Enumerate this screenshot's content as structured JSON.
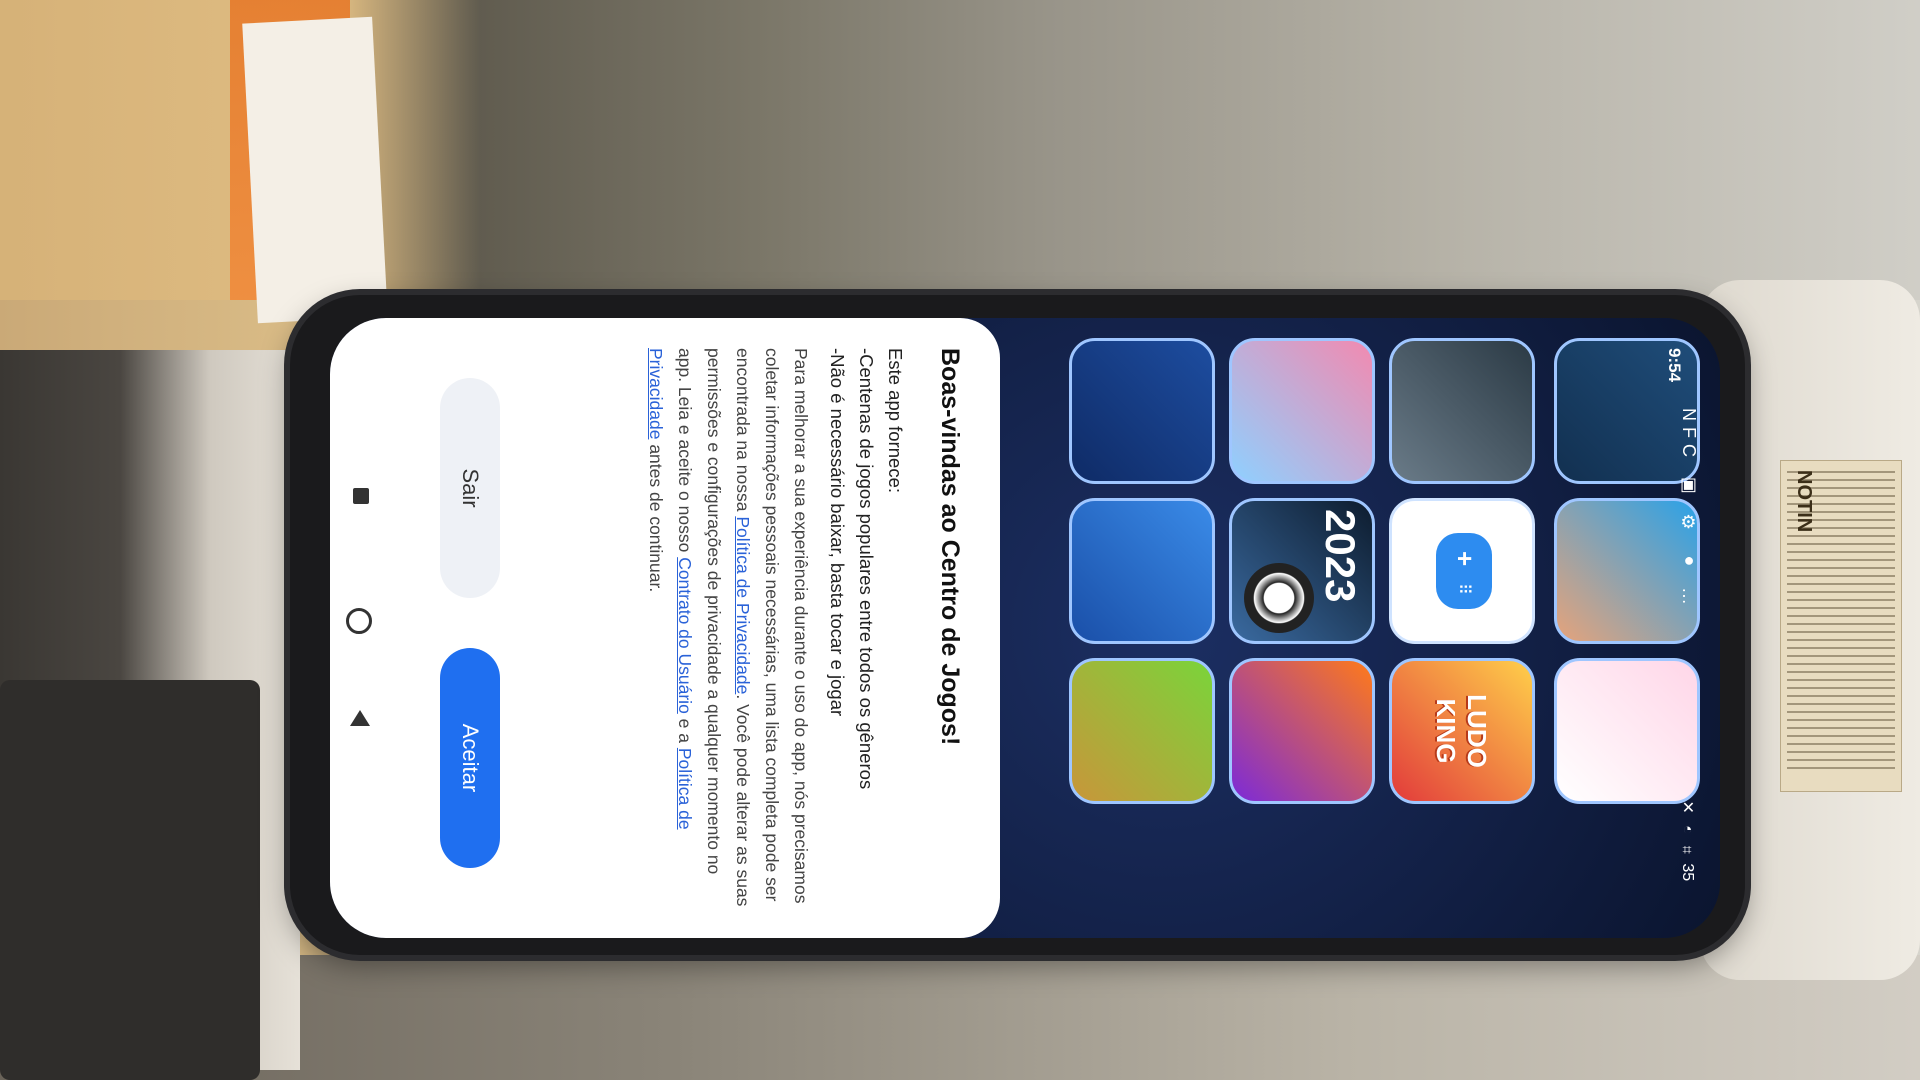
{
  "status_bar": {
    "time": "9:54",
    "icons": "NFC ▣ ⚙ ● …",
    "right_icons": "✕ ◔ ⌗ 35"
  },
  "label_sticker": "NOTIN",
  "grid": {
    "tiles": [
      "tile-tetris",
      "tile-subway",
      "tile-cat",
      "tile-dark",
      "tile-game-center",
      "tile-ludo",
      "tile-pink",
      "tile-2023",
      "tile-candy",
      "tile-road",
      "tile-blue",
      "tile-green"
    ],
    "ludo_label": "LUDO KING",
    "soccer_label": "2023"
  },
  "dialog": {
    "title": "Boas-vindas ao Centro de Jogos!",
    "intro": "Este app fornece:",
    "point1": "-Centenas de jogos populares entre todos os gêneros",
    "point2": "-Não é necessário baixar, basta tocar e jogar",
    "para_part1": "Para melhorar a sua experiência durante o uso do app, nós precisamos coletar informações pessoais necessárias, uma lista completa pode ser encontrada na nossa ",
    "link_privacy": "Política de Privacidade",
    "para_part2": ". Você pode alterar as suas permissões e configurações de privacidade a qualquer momento no app. Leia e aceite o nosso ",
    "link_contract": "Contrato do Usuário",
    "para_part3": " e a ",
    "link_privacy2": "Política de Privacidade",
    "para_part4": " antes de continuar.",
    "btn_exit": "Sair",
    "btn_accept": "Aceitar"
  },
  "colors": {
    "accent": "#1f6ff0",
    "link": "#2a62d8"
  }
}
